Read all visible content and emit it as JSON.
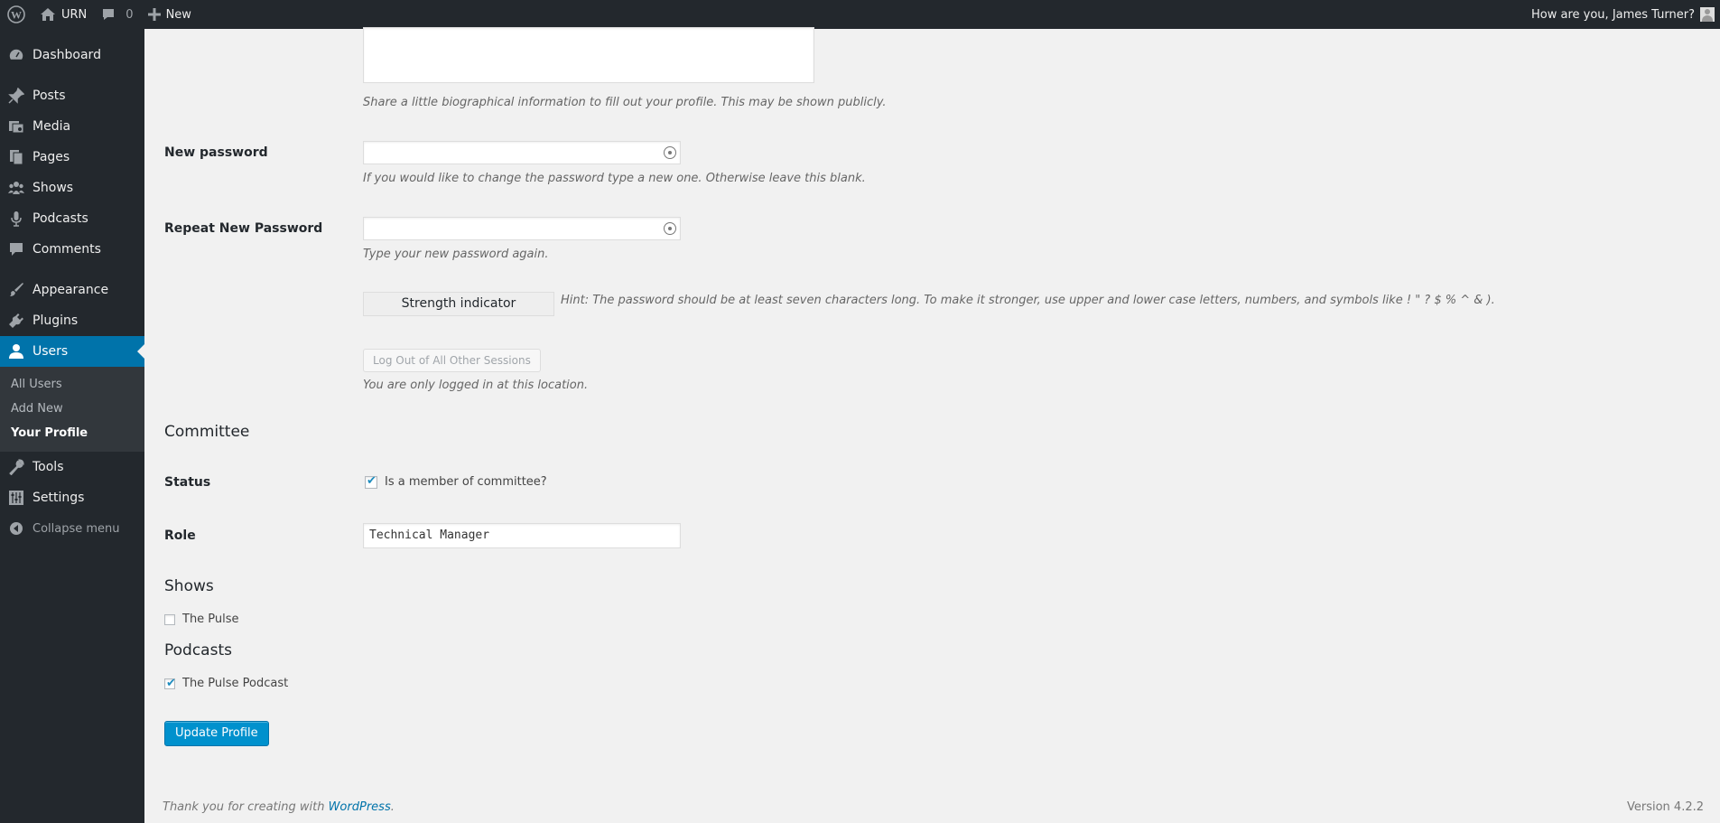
{
  "adminbar": {
    "site_name": "URN",
    "comments_count": "0",
    "new_label": "New",
    "greeting": "How are you, James Turner?"
  },
  "sidebar": {
    "items": [
      {
        "label": "Dashboard",
        "icon": "dashboard-icon"
      },
      {
        "label": "Posts",
        "icon": "pin-icon"
      },
      {
        "label": "Media",
        "icon": "media-icon"
      },
      {
        "label": "Pages",
        "icon": "pages-icon"
      },
      {
        "label": "Shows",
        "icon": "groups-icon"
      },
      {
        "label": "Podcasts",
        "icon": "microphone-icon"
      },
      {
        "label": "Comments",
        "icon": "comment-icon"
      },
      {
        "label": "Appearance",
        "icon": "paintbrush-icon"
      },
      {
        "label": "Plugins",
        "icon": "plugin-icon"
      },
      {
        "label": "Users",
        "icon": "user-icon"
      },
      {
        "label": "Tools",
        "icon": "wrench-icon"
      },
      {
        "label": "Settings",
        "icon": "settings-icon"
      }
    ],
    "users_submenu": [
      "All Users",
      "Add New",
      "Your Profile"
    ],
    "collapse_label": "Collapse menu"
  },
  "profile": {
    "bio_description": "Share a little biographical information to fill out your profile. This may be shown publicly.",
    "new_password_label": "New password",
    "new_password_desc": "If you would like to change the password type a new one. Otherwise leave this blank.",
    "repeat_password_label": "Repeat New Password",
    "repeat_password_desc": "Type your new password again.",
    "strength_label": "Strength indicator",
    "strength_hint": "Hint: The password should be at least seven characters long. To make it stronger, use upper and lower case letters, numbers, and symbols like ! \" ? $ % ^ & ).",
    "logout_sessions_label": "Log Out of All Other Sessions",
    "logout_sessions_desc": "You are only logged in at this location."
  },
  "committee": {
    "heading": "Committee",
    "status_label": "Status",
    "member_checkbox_label": "Is a member of committee?",
    "member_checked": true,
    "role_label": "Role",
    "role_value": "Technical Manager"
  },
  "shows": {
    "heading": "Shows",
    "items": [
      {
        "label": "The Pulse",
        "checked": false
      }
    ]
  },
  "podcasts": {
    "heading": "Podcasts",
    "items": [
      {
        "label": "The Pulse Podcast",
        "checked": true
      }
    ]
  },
  "update_button": "Update Profile",
  "footer": {
    "thanks_prefix": "Thank you for creating with ",
    "wordpress_link": "WordPress",
    "thanks_suffix": ".",
    "version": "Version 4.2.2"
  },
  "colors": {
    "adminbar_bg": "#23282d",
    "accent": "#0073aa",
    "primary_button": "#0091cd",
    "content_bg": "#f1f1f1"
  }
}
